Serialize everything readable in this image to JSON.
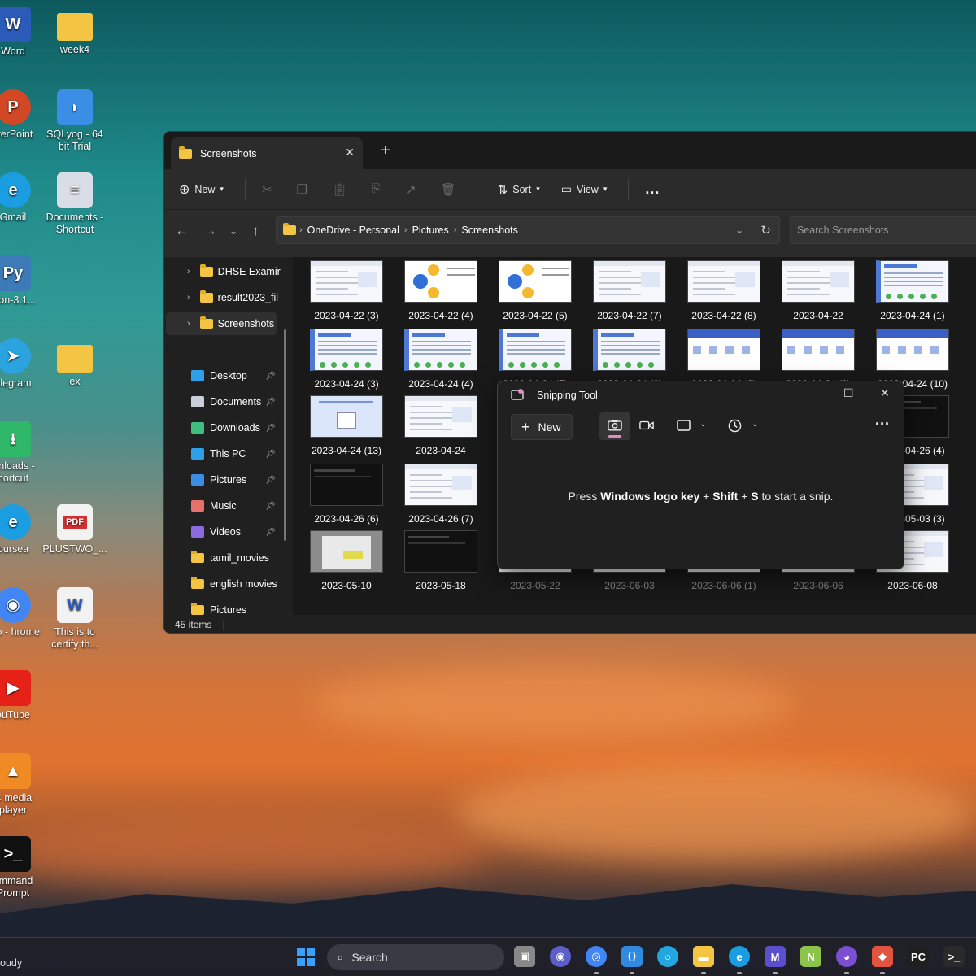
{
  "desktop": {
    "icons": [
      {
        "label": "Word",
        "icon": "word-icon",
        "color": "#2b5bb8"
      },
      {
        "label": "week4",
        "icon": "folder-icon",
        "color": "#f4c542"
      },
      {
        "label": "werPoint",
        "icon": "powerpoint-icon",
        "color": "#d24726"
      },
      {
        "label": "SQLyog - 64 bit Trial",
        "icon": "dolphin-icon",
        "color": "#3a8ee6"
      },
      {
        "label": "Gmail",
        "icon": "edge-icon",
        "color": "#1b9de2"
      },
      {
        "label": "Documents - Shortcut",
        "icon": "documents-icon",
        "color": "#d9dde6"
      },
      {
        "label": "thon-3.1...",
        "icon": "python-icon",
        "color": "#3d7ab8"
      },
      {
        "label": "elegram",
        "icon": "telegram-icon",
        "color": "#2aa3de"
      },
      {
        "label": "ex",
        "icon": "folder-icon",
        "color": "#f4c542"
      },
      {
        "label": "wnloads - hortcut",
        "icon": "downloads-icon",
        "color": "#2fb86a"
      },
      {
        "label": "oursea",
        "icon": "edge-icon",
        "color": "#1b9de2"
      },
      {
        "label": "PLUSTWO_...",
        "icon": "pdf-icon",
        "color": "#d32f2f"
      },
      {
        "label": "Lijo - hrome",
        "icon": "chrome-icon",
        "color": "#4285f4"
      },
      {
        "label": "This is to certify th...",
        "icon": "word-doc-icon",
        "color": "#2b5bb8"
      },
      {
        "label": "ouTube",
        "icon": "youtube-icon",
        "color": "#e62117"
      },
      {
        "label": "C media player",
        "icon": "vlc-icon",
        "color": "#f08a24"
      },
      {
        "label": "ommand Prompt",
        "icon": "cmd-icon",
        "color": "#111111"
      }
    ],
    "pdf_badge": "PDF"
  },
  "explorer": {
    "tab_title": "Screenshots",
    "toolbar": {
      "new_label": "New",
      "sort_label": "Sort",
      "view_label": "View",
      "more_label": "..."
    },
    "breadcrumb": [
      "OneDrive - Personal",
      "Pictures",
      "Screenshots"
    ],
    "search_placeholder": "Search Screenshots",
    "nav": [
      {
        "label": "DHSE Examir",
        "type": "folder",
        "expandable": true
      },
      {
        "label": "result2023_fil",
        "type": "folder",
        "expandable": true
      },
      {
        "label": "Screenshots",
        "type": "folder",
        "expandable": true,
        "selected": true
      },
      {
        "label": "Desktop",
        "type": "desktop",
        "pinned": true
      },
      {
        "label": "Documents",
        "type": "documents",
        "pinned": true
      },
      {
        "label": "Downloads",
        "type": "downloads",
        "pinned": true
      },
      {
        "label": "This PC",
        "type": "pc",
        "pinned": true
      },
      {
        "label": "Pictures",
        "type": "pictures",
        "pinned": true
      },
      {
        "label": "Music",
        "type": "music",
        "pinned": true
      },
      {
        "label": "Videos",
        "type": "videos",
        "pinned": true
      },
      {
        "label": "tamil_movies",
        "type": "folder"
      },
      {
        "label": "english movies",
        "type": "folder"
      },
      {
        "label": "Pictures",
        "type": "folder"
      }
    ],
    "files": [
      {
        "name": "2023-04-22 (3)",
        "kind": "light"
      },
      {
        "name": "2023-04-22 (4)",
        "kind": "diagram"
      },
      {
        "name": "2023-04-22 (5)",
        "kind": "diagram"
      },
      {
        "name": "2023-04-22 (7)",
        "kind": "light"
      },
      {
        "name": "2023-04-22 (8)",
        "kind": "light"
      },
      {
        "name": "2023-04-22",
        "kind": "light"
      },
      {
        "name": "2023-04-24 (1)",
        "kind": "blue"
      },
      {
        "name": "2023-04-24 (3)",
        "kind": "blue"
      },
      {
        "name": "2023-04-24 (4)",
        "kind": "blue"
      },
      {
        "name": "2023-04-24 (5)",
        "kind": "blue"
      },
      {
        "name": "2023-04-24 (6)",
        "kind": "blue"
      },
      {
        "name": "2023-04-24 (8)",
        "kind": "slide"
      },
      {
        "name": "2023-04-24 (9)",
        "kind": "slide"
      },
      {
        "name": "2023-04-24 (10)",
        "kind": "slide"
      },
      {
        "name": "2023-04-24 (13)",
        "kind": "cloud"
      },
      {
        "name": "2023-04-24",
        "kind": "light"
      },
      {
        "name": "2023-04-26 (4)",
        "kind": "dark"
      },
      {
        "name": "2023-04-26 (6)",
        "kind": "dark"
      },
      {
        "name": "2023-04-26 (7)",
        "kind": "light"
      },
      {
        "name": "2023-05-03 (3)",
        "kind": "light"
      },
      {
        "name": "2023-05-10",
        "kind": "gray"
      },
      {
        "name": "2023-05-18",
        "kind": "dark"
      },
      {
        "name": "2023-05-22",
        "kind": "light"
      },
      {
        "name": "2023-06-03",
        "kind": "light"
      },
      {
        "name": "2023-06-06 (1)",
        "kind": "light"
      },
      {
        "name": "2023-06-06",
        "kind": "light"
      },
      {
        "name": "2023-06-08",
        "kind": "light"
      }
    ],
    "status": "45 items"
  },
  "snipping_tool": {
    "title": "Snipping Tool",
    "new_label": "New",
    "msg_prefix": "Press ",
    "msg_key1": "Windows logo key",
    "msg_plus1": " + ",
    "msg_key2": "Shift",
    "msg_plus2": " + ",
    "msg_key3": "S",
    "msg_suffix": " to start a snip."
  },
  "taskbar": {
    "weather_text": "oudy",
    "search_label": "Search",
    "apps": [
      {
        "name": "task-view-icon",
        "color": "#888888"
      },
      {
        "name": "teams-chat-icon",
        "color": "#5b5fc7"
      },
      {
        "name": "chrome-icon",
        "color": "#4285f4"
      },
      {
        "name": "vscode-icon",
        "color": "#2f8ae0"
      },
      {
        "name": "cortana-icon",
        "color": "#22a7e0"
      },
      {
        "name": "file-explorer-icon",
        "color": "#f4c542"
      },
      {
        "name": "edge-icon",
        "color": "#1b9de2"
      },
      {
        "name": "mathpix-icon",
        "color": "#5a4fcf"
      },
      {
        "name": "notepadpp-icon",
        "color": "#8cc34a"
      },
      {
        "name": "github-icon",
        "color": "#7a4fd0"
      },
      {
        "name": "git-icon",
        "color": "#e3543f"
      },
      {
        "name": "pycharm-icon",
        "color": "#1f1f1f"
      },
      {
        "name": "terminal-icon",
        "color": "#2a2a2a"
      }
    ]
  }
}
